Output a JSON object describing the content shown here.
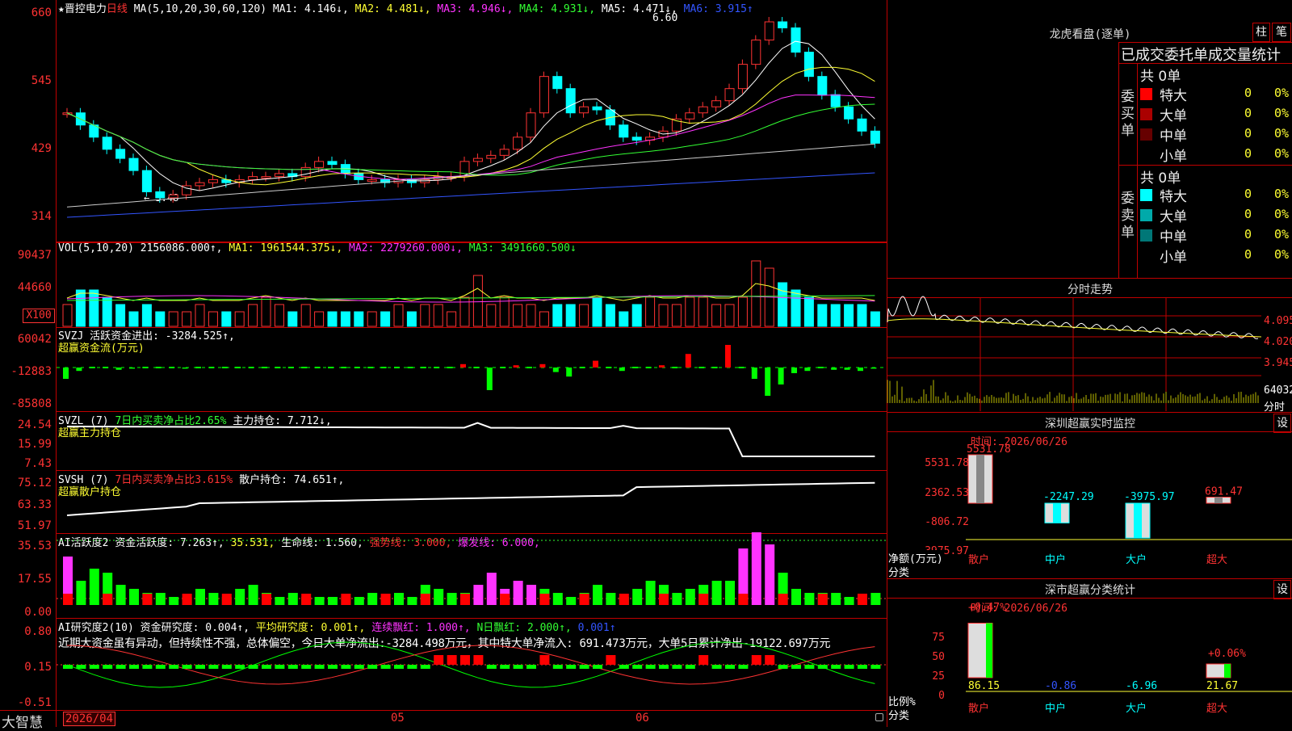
{
  "header": {
    "star": "★",
    "stock": "晋控电力",
    "period": "日线",
    "ma_label": "MA(5,10,20,30,60,120)",
    "ma1": "MA1: 4.146↓,",
    "ma2": "MA2: 4.481↓,",
    "ma3": "MA3: 4.946↓,",
    "ma4": "MA4: 4.931↓,",
    "ma5": "MA5: 4.471↓,",
    "ma6": "MA6: 3.915↑",
    "high_mark": "6.60",
    "low_mark": "← 3.48"
  },
  "price_axis": [
    "660",
    "545",
    "429",
    "314"
  ],
  "vol": {
    "label": "VOL(5,10,20)",
    "value": "2156086.000↑,",
    "ma1": "MA1: 1961544.375↓,",
    "ma2": "MA2: 2279260.000↓,",
    "ma3": "MA3: 3491660.500↓",
    "axis": [
      "90437",
      "44660"
    ],
    "unit": "X100"
  },
  "svzj": {
    "label": "SVZJ  活跃资金进出: -3284.525↑,",
    "sub": "超赢资金流(万元)",
    "axis": [
      "60042",
      "-12883",
      "-85808"
    ]
  },
  "svzl": {
    "label": "SVZL (7)",
    "p1": "7日内买卖净占比2.65%",
    "p2": "主力持仓: 7.712↓,",
    "sub": "超赢主力持仓",
    "axis": [
      "24.54",
      "15.99",
      "7.43"
    ]
  },
  "svsh": {
    "label": "SVSH (7)",
    "p1": "7日内买卖净占比3.615%",
    "p2": "散户持仓: 74.651↑,",
    "sub": "超赢散户持仓",
    "axis": [
      "75.12",
      "63.33",
      "51.97"
    ]
  },
  "ai1": {
    "label": "AI活跃度2",
    "p1": "资金活跃度: 7.263↑,",
    "p2": "35.531,",
    "p3": "生命线: 1.560,",
    "p4": "强势线: 3.000,",
    "p5": "爆发线: 6.000,",
    "axis": [
      "35.53",
      "17.55",
      "0.00"
    ]
  },
  "ai2": {
    "label": "AI研究度2(10)",
    "p1": "资金研究度: 0.004↑,",
    "p2": "平均研究度: 0.001↑,",
    "p3": "连续飘红: 1.000↑,",
    "p4": "N日飘红: 2.000↑,",
    "p5": "0.001↑",
    "comment": "近期大资金虽有异动，但持续性不强，总体偏空，今日大单净流出:-3284.498万元，其中特大单净流入: 691.473万元，大单5日累计净出-19122.697万元",
    "axis": [
      "0.80",
      "0.15",
      "-0.51"
    ]
  },
  "footer": {
    "brand": "大智慧",
    "date1": "2026/04",
    "m05": "05",
    "m06": "06"
  },
  "lhb": {
    "title": "龙虎看盘(逐单)",
    "btn1": "柱",
    "btn2": "笔",
    "subtitle": "已成交委托单成交量统计",
    "buy_label": "委买单",
    "sell_label": "委卖单",
    "buy_total": "共 0单",
    "sell_total": "共 0单",
    "buy_rows": [
      {
        "name": "特大",
        "color": "#ff0000",
        "v": "0",
        "p": "0%"
      },
      {
        "name": "大单",
        "color": "#aa0000",
        "v": "0",
        "p": "0%"
      },
      {
        "name": "中单",
        "color": "#660000",
        "v": "0",
        "p": "0%"
      },
      {
        "name": "小单",
        "color": "#000000",
        "v": "0",
        "p": "0%"
      }
    ],
    "sell_rows": [
      {
        "name": "特大",
        "color": "#00ffff",
        "v": "0",
        "p": "0%"
      },
      {
        "name": "大单",
        "color": "#00aaaa",
        "v": "0",
        "p": "0%"
      },
      {
        "name": "中单",
        "color": "#007777",
        "v": "0",
        "p": "0%"
      },
      {
        "name": "小单",
        "color": "#000000",
        "v": "0",
        "p": "0%"
      }
    ]
  },
  "intraday": {
    "title": "分时走势",
    "axis": [
      "4.095",
      "4.020",
      "3.945"
    ],
    "vol_label": "64032",
    "time_label": "分时"
  },
  "monitor": {
    "title": "深圳超赢实时监控",
    "btn": "设",
    "time": "时间: 2026/06/26",
    "axis": [
      "5531.78",
      "2362.53",
      "-806.72",
      "-3975.97"
    ],
    "y_name": "净额(万元)",
    "x_name": "分类",
    "cats": [
      "散户",
      "中户",
      "大户",
      "超大"
    ],
    "values": [
      5531.78,
      -2247.29,
      -3975.97,
      691.47
    ],
    "value_labels": [
      "5531.78",
      "-2247.29",
      "-3975.97",
      "691.47"
    ]
  },
  "classify": {
    "title": "深市超赢分类统计",
    "btn": "设",
    "time": "时间: 2026/06/26",
    "axis": [
      "75",
      "50",
      "25",
      "0"
    ],
    "y_name": "比例%",
    "x_name": "分类",
    "cats": [
      "散户",
      "中户",
      "大户",
      "超大"
    ],
    "values": [
      86.15,
      -0.86,
      -6.96,
      21.67
    ],
    "value_labels": [
      "86.15",
      "-0.86",
      "-6.96",
      "21.67"
    ],
    "top_labels": [
      "+0.47%",
      "+0.06%"
    ]
  }
}
